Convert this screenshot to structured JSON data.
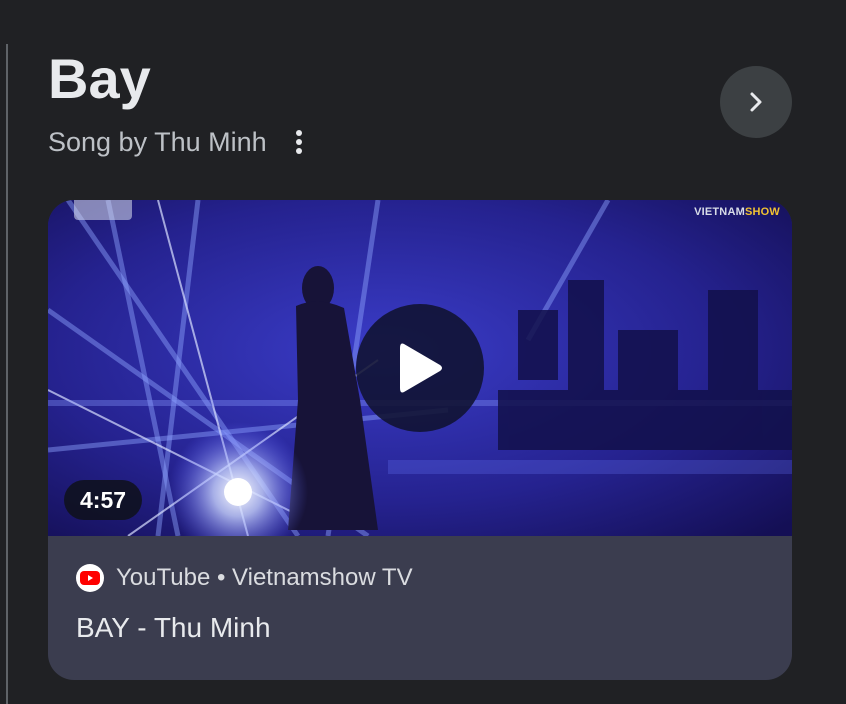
{
  "header": {
    "title": "Bay",
    "subtitle": "Song by Thu Minh"
  },
  "icons": {
    "more": "more-vert-icon",
    "next": "chevron-right-icon",
    "play": "play-icon",
    "source": "youtube-icon"
  },
  "video": {
    "duration": "4:57",
    "source": "YouTube • Vietnamshow TV",
    "title": "BAY - Thu Minh",
    "watermark_main": "VIETNAM",
    "watermark_accent": "SHOW"
  },
  "colors": {
    "background": "#202124",
    "card": "#3b3d4f",
    "youtube_red": "#ff0000"
  }
}
